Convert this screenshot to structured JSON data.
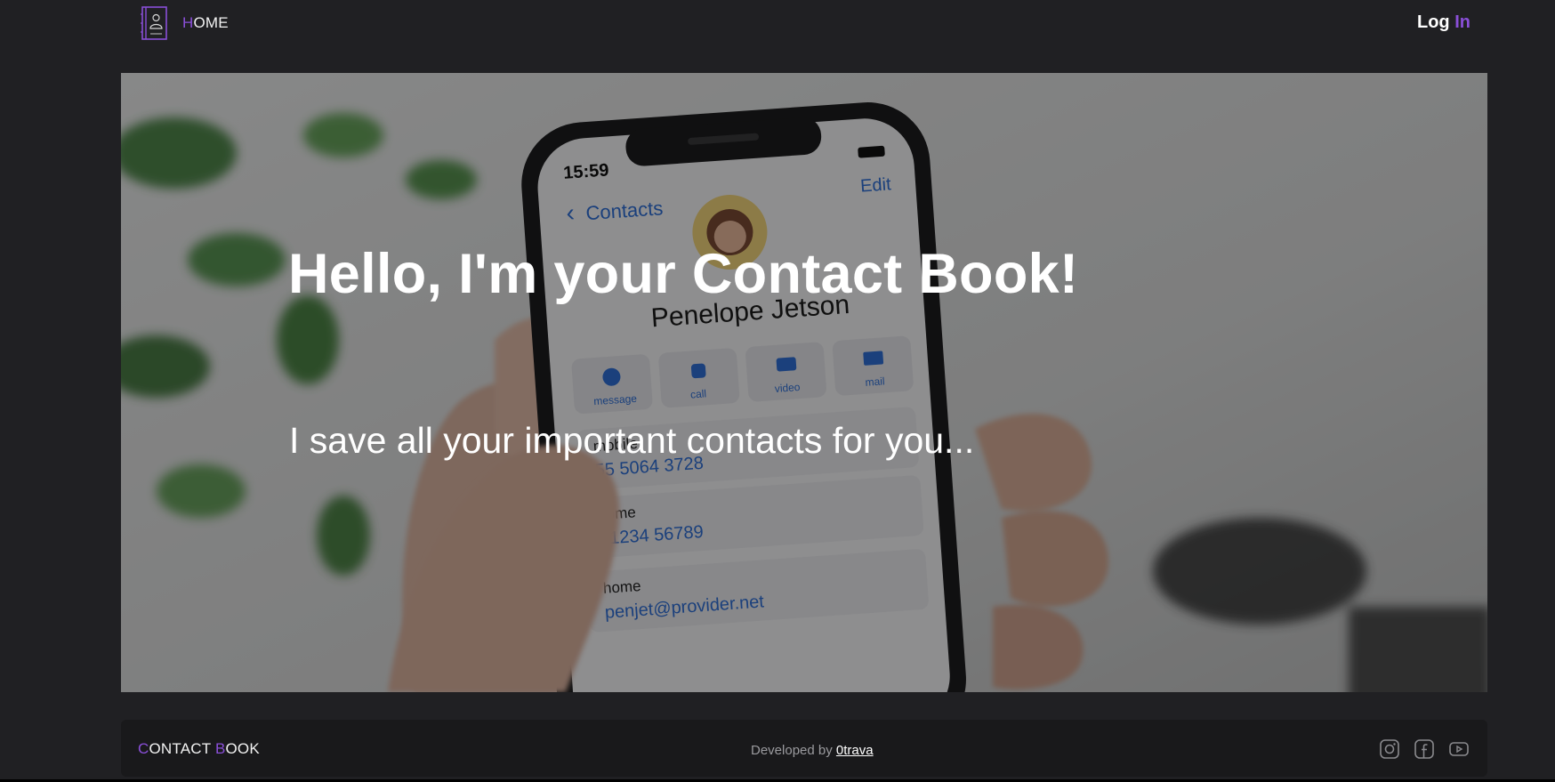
{
  "nav": {
    "home_first": "H",
    "home_rest": "OME",
    "login_main": "Log",
    "login_accent": "In",
    "logo_icon": "contact-book-icon"
  },
  "hero": {
    "title": "Hello, I'm your Contact Book!",
    "subtitle": "I save all your important contacts for you...",
    "phone_screen": {
      "time": "15:59",
      "back_label": "Contacts",
      "edit_label": "Edit",
      "contact_name": "Penelope Jetson",
      "actions": [
        "message",
        "call",
        "video",
        "mail"
      ],
      "fields": [
        {
          "label": "mobile",
          "value": "55 5064 3728"
        },
        {
          "label": "home",
          "value": "01234 56789"
        },
        {
          "label": "home",
          "value": "penjet@provider.net"
        }
      ]
    }
  },
  "footer": {
    "brand_c": "C",
    "brand_ontact": "ONTACT ",
    "brand_b": "B",
    "brand_ook": "OOK",
    "credit_prefix": "Developed by ",
    "credit_author": "0trava",
    "social_icons": [
      "instagram-icon",
      "facebook-icon",
      "youtube-icon"
    ]
  },
  "colors": {
    "accent": "#8a4fd8",
    "background": "#202023",
    "footer_bg": "#19191b",
    "phone_link_blue": "#2f6fd6"
  }
}
